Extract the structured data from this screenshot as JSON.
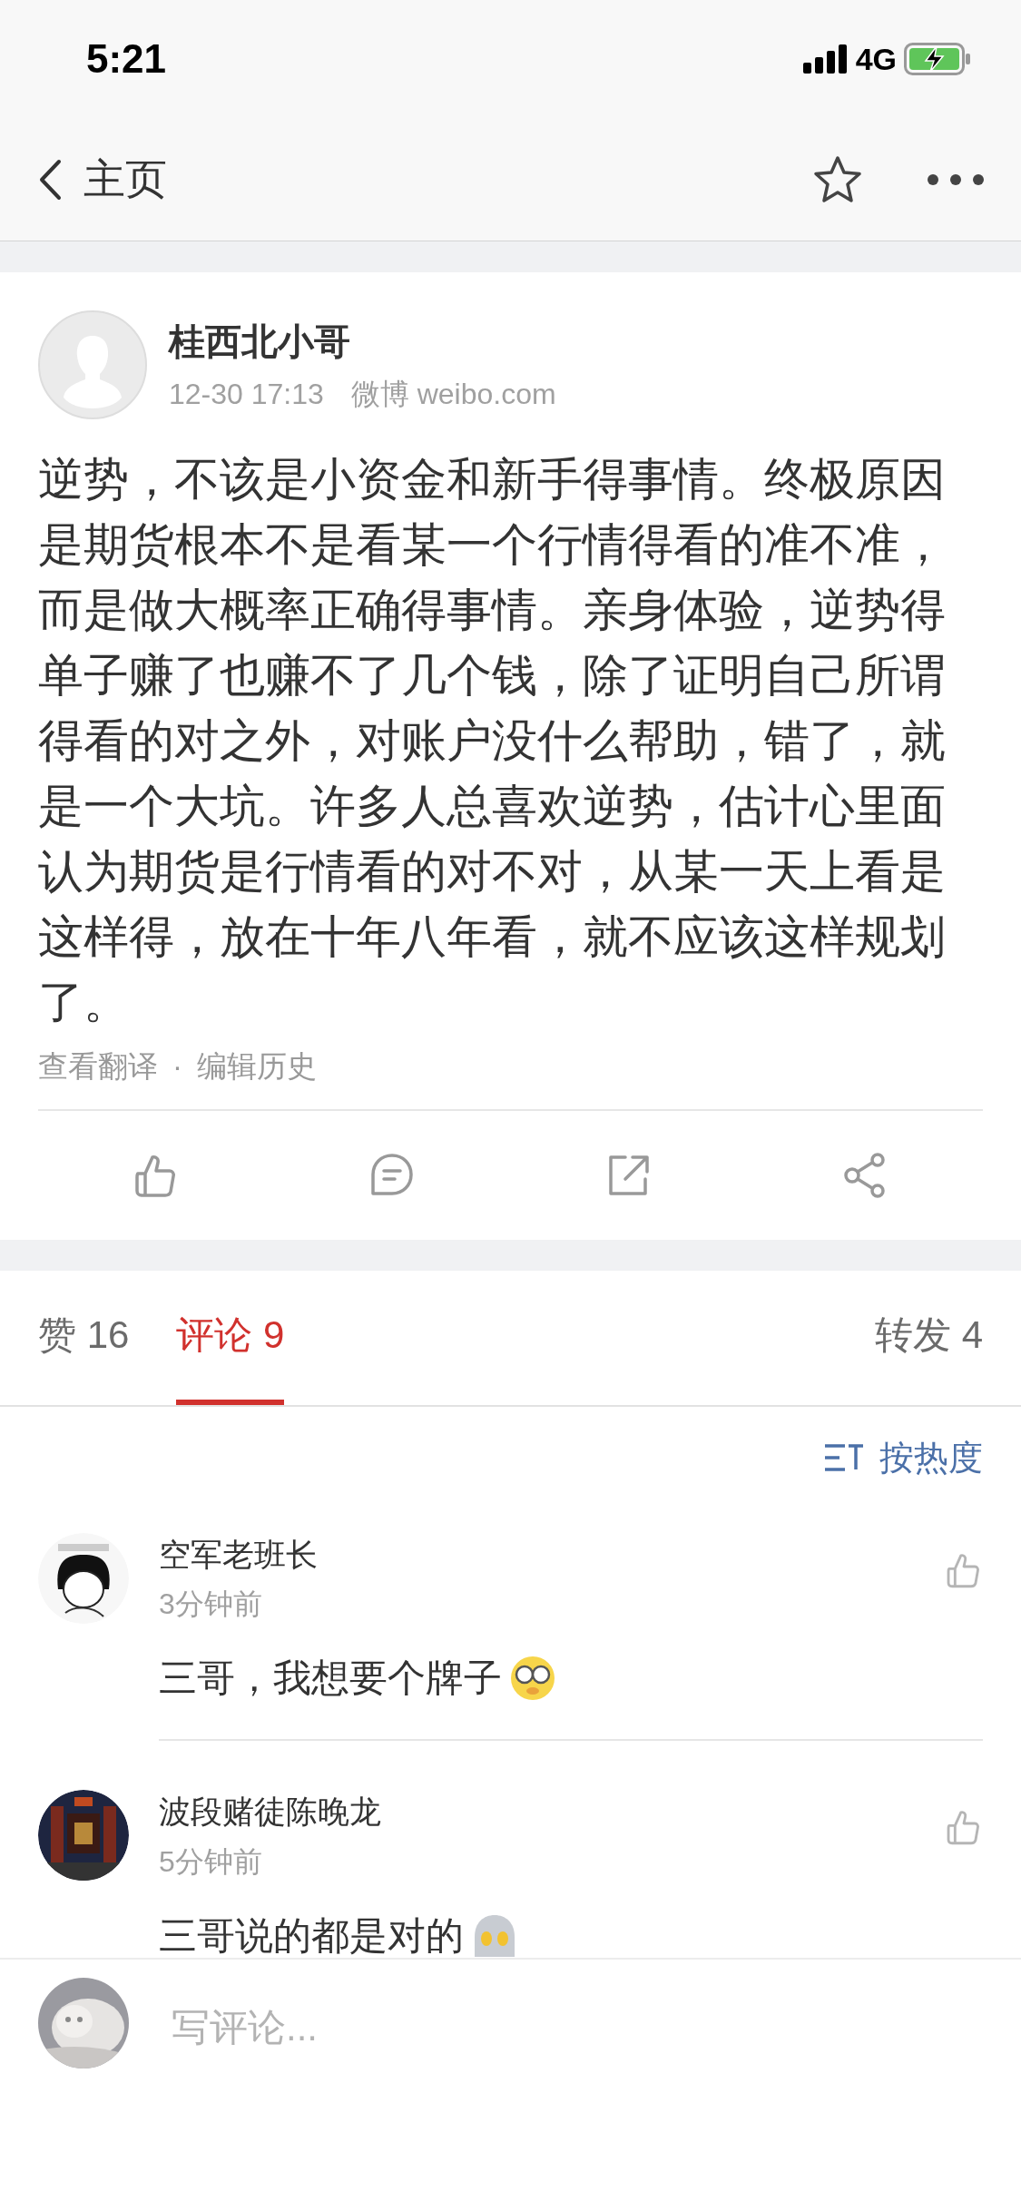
{
  "status_bar": {
    "time": "5:21",
    "network": "4G"
  },
  "nav": {
    "back_label": "主页"
  },
  "post": {
    "author": "桂西北小哥",
    "time": "12-30 17:13",
    "source": "微博 weibo.com",
    "text": "逆势，不该是小资金和新手得事情。终极原因是期货根本不是看某一个行情得看的准不准，而是做大概率正确得事情。亲身体验，逆势得单子赚了也赚不了几个钱，除了证明自己所谓得看的对之外，对账户没什么帮助，错了，就是一个大坑。许多人总喜欢逆势，估计心里面认为期货是行情看的对不对，从某一天上看是这样得，放在十年八年看，就不应该这样规划了。",
    "links": [
      "查看翻译",
      "编辑历史"
    ],
    "separator": "·"
  },
  "tabs": [
    {
      "label": "赞 16",
      "selected": false
    },
    {
      "label": "评论 9",
      "selected": true
    },
    {
      "label": "转发 4",
      "selected": false
    }
  ],
  "sort": "按热度",
  "comments": [
    {
      "name": "空军老班长",
      "time": "3分钟前",
      "text": "三哥，我想要个牌子"
    },
    {
      "name": "波段赌徒陈晚龙",
      "time": "5分钟前",
      "text": "三哥说的都是对的"
    }
  ],
  "composer": {
    "placeholder": "写评论..."
  }
}
